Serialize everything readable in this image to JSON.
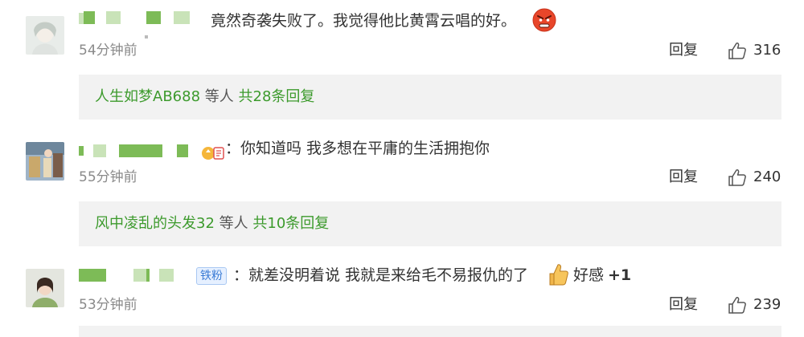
{
  "comments": [
    {
      "text": "竟然奇袭失败了。我觉得他比黄霄云唱的好。",
      "emoji": "angry-face",
      "time": "54分钟前",
      "reply_label": "回复",
      "likes": "316",
      "replies": {
        "user": "人生如梦AB688",
        "mid": "等人",
        "count": "共28条回复"
      }
    },
    {
      "text": "：你知道吗 我多想在平庸的生活拥抱你",
      "time": "55分钟前",
      "reply_label": "回复",
      "likes": "240",
      "replies": {
        "user": "风中凌乱的头发32",
        "mid": "等人",
        "count": "共10条回复"
      }
    },
    {
      "badge": "铁粉",
      "text": "：就差没明着说 我就是来给毛不易报仇的了",
      "suffix": "好感",
      "plus": "+1",
      "time": "53分钟前",
      "reply_label": "回复",
      "likes": "239"
    }
  ],
  "colors": {
    "accent_green": "#3c9a2c",
    "name_block": "#7dbb57",
    "reply_bg": "#f2f2f2"
  }
}
